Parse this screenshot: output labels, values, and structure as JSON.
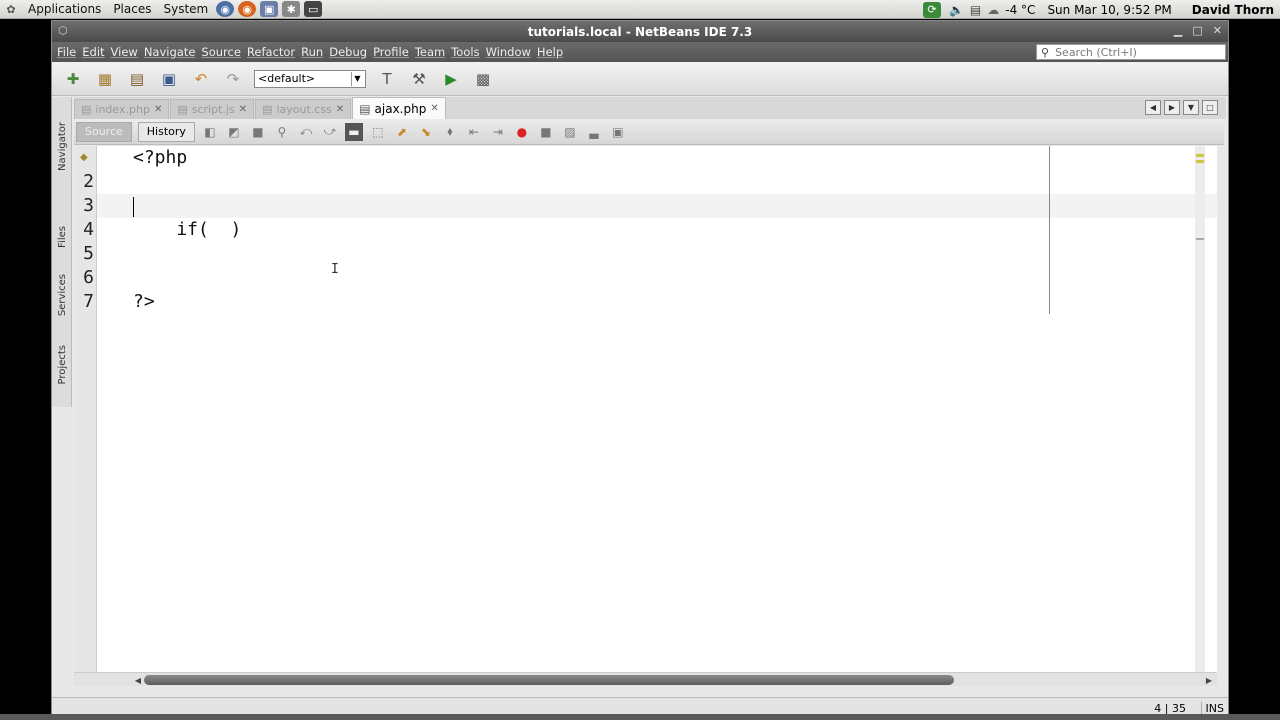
{
  "top_panel": {
    "menus": [
      "Applications",
      "Places",
      "System"
    ],
    "weather": "-4 °C",
    "datetime": "Sun Mar 10,  9:52 PM",
    "user": "David Thorn"
  },
  "window": {
    "title": "tutorials.local - NetBeans IDE 7.3"
  },
  "menubar": {
    "items": [
      "File",
      "Edit",
      "View",
      "Navigate",
      "Source",
      "Refactor",
      "Run",
      "Debug",
      "Profile",
      "Team",
      "Tools",
      "Window",
      "Help"
    ]
  },
  "search": {
    "placeholder": "Search (Ctrl+I)"
  },
  "toolbar": {
    "config_value": "<default>"
  },
  "side_panel": {
    "labels": [
      "Navigator",
      "Files",
      "Services",
      "Projects"
    ]
  },
  "tabs": [
    {
      "label": "index.php",
      "active": false
    },
    {
      "label": "script.js",
      "active": false
    },
    {
      "label": "layout.css",
      "active": false
    },
    {
      "label": "ajax.php",
      "active": true
    }
  ],
  "editor_toolbar": {
    "source_label": "Source",
    "history_label": "History"
  },
  "editor": {
    "line_numbers": [
      "2",
      "3",
      "4",
      "5",
      "6",
      "7"
    ],
    "lines": [
      {
        "text": "<?php"
      },
      {
        "text": ""
      },
      {
        "text": ""
      },
      {
        "text": "    if(  )"
      },
      {
        "text": ""
      },
      {
        "text": ""
      },
      {
        "text": "?>"
      }
    ]
  },
  "statusbar": {
    "position": "4 | 35",
    "mode": "INS"
  }
}
